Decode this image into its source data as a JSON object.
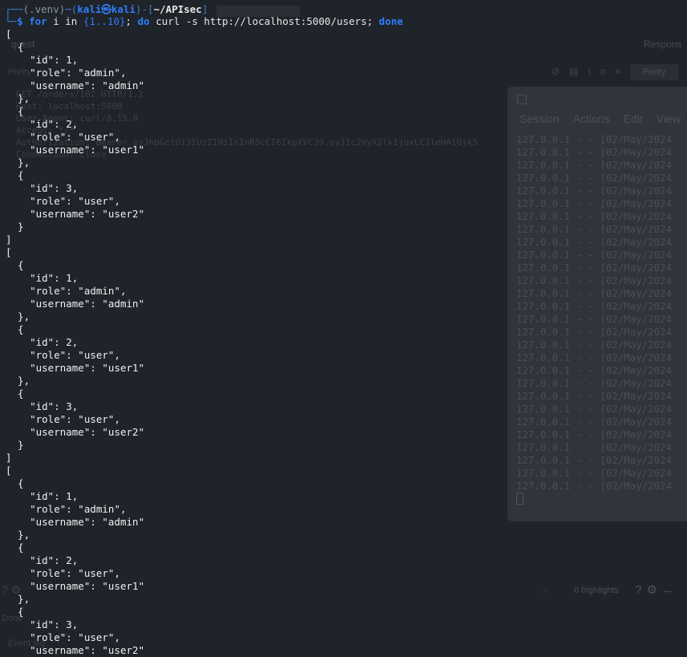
{
  "terminal": {
    "prompt": {
      "venv": "(.venv)",
      "user_host": "kali㉿kali",
      "cwd": "~/APIsec",
      "command_for": "for",
      "command_var": " i in ",
      "command_range": "{1..10}",
      "command_do_sep": "; ",
      "command_do": "do",
      "command_curl": " curl -s http://localhost:5000/users",
      "command_done_sep": "; ",
      "command_done": "done"
    },
    "output_lines": [
      "[",
      "  {",
      "    \"id\": 1,",
      "    \"role\": \"admin\",",
      "    \"username\": \"admin\"",
      "  },",
      "  {",
      "    \"id\": 2,",
      "    \"role\": \"user\",",
      "    \"username\": \"user1\"",
      "  },",
      "  {",
      "    \"id\": 3,",
      "    \"role\": \"user\",",
      "    \"username\": \"user2\"",
      "  }",
      "]",
      "[",
      "  {",
      "    \"id\": 1,",
      "    \"role\": \"admin\",",
      "    \"username\": \"admin\"",
      "  },",
      "  {",
      "    \"id\": 2,",
      "    \"role\": \"user\",",
      "    \"username\": \"user1\"",
      "  },",
      "  {",
      "    \"id\": 3,",
      "    \"role\": \"user\",",
      "    \"username\": \"user2\"",
      "  }",
      "]",
      "[",
      "  {",
      "    \"id\": 1,",
      "    \"role\": \"admin\",",
      "    \"username\": \"admin\"",
      "  },",
      "  {",
      "    \"id\": 2,",
      "    \"role\": \"user\",",
      "    \"username\": \"user1\"",
      "  },",
      "  {",
      "    \"id\": 3,",
      "    \"role\": \"user\",",
      "    \"username\": \"user2\""
    ]
  },
  "log_window": {
    "menu": [
      "Session",
      "Actions",
      "Edit",
      "View"
    ],
    "line_text": "127.0.0.1 - - [02/May/2024",
    "line_count": 28
  },
  "background": {
    "request_header": "quest",
    "response_header": "Respons",
    "pretty_left": "Pretty",
    "pretty_right": "Pretty",
    "request_lines": [
      "GET /orders/102 HTTP/1.1",
      "Host: localhost:5000",
      "User-Agent: curl/8.15.0",
      "Accept: */*",
      "Authorization: Bearer eyJhbGciOiJIUzI1NiIsInR5cCI6IkpXVCJ9.eyJ1c2VyX2lkIjoxLCJleHAiOjk5",
      "Connection: close"
    ],
    "highlights": "0 highlights",
    "bottom_text1": "Done",
    "bottom_text2": "Event log"
  },
  "colors": {
    "terminal_bg": "#1f232a",
    "prompt_blue": "#2d7ff9",
    "text": "#f0f0f0"
  }
}
